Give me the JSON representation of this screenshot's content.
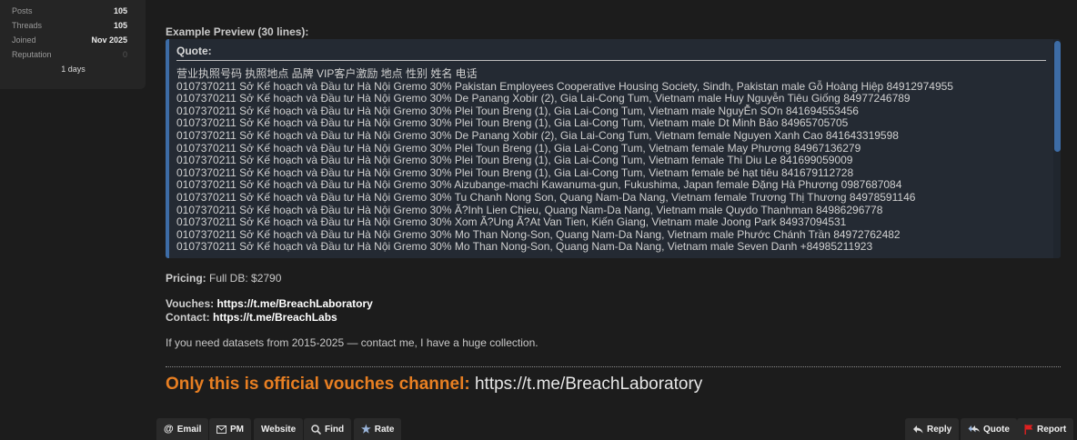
{
  "user_stats": {
    "posts_label": "Posts",
    "posts_value": "105",
    "threads_label": "Threads",
    "threads_value": "105",
    "joined_label": "Joined",
    "joined_value": "Nov 2025",
    "reputation_label": "Reputation",
    "reputation_value": "0",
    "days": "1 days"
  },
  "preview": {
    "title": "Example Preview (30 lines):",
    "quote_label": "Quote:",
    "lines": [
      "营业执照号码 执照地点 品牌 VIP客户激励 地点 性别 姓名 电话",
      "0107370211 Sở Kế hoạch và Đầu tư Hà Nội Gremo 30% Pakistan Employees Cooperative Housing Society, Sindh, Pakistan male Gỗ Hoàng Hiệp 84912974955",
      "0107370211 Sở Kế hoạch và Đầu tư Hà Nội Gremo 30% De Panang Xobir (2), Gia Lai-Cong Tum, Vietnam male Huy Nguyễn Tiêu Giống 84977246789",
      "0107370211 Sở Kế hoạch và Đầu tư Hà Nội Gremo 30% Plei Toun Breng (1), Gia Lai-Cong Tum, Vietnam male NguyỄn SƠn 841694553456",
      "0107370211 Sở Kế hoạch và Đầu tư Hà Nội Gremo 30% Plei Toun Breng (1), Gia Lai-Cong Tum, Vietnam male Dt Minh Bảo 84965705705",
      "0107370211 Sở Kế hoạch và Đầu tư Hà Nội Gremo 30% De Panang Xobir (2), Gia Lai-Cong Tum, Vietnam female Nguyen Xanh Cao 841643319598",
      "0107370211 Sở Kế hoạch và Đầu tư Hà Nội Gremo 30% Plei Toun Breng (1), Gia Lai-Cong Tum, Vietnam female May Phương 84967136279",
      "0107370211 Sở Kế hoạch và Đầu tư Hà Nội Gremo 30% Plei Toun Breng (1), Gia Lai-Cong Tum, Vietnam female Thi Diu Le 841699059009",
      "0107370211 Sở Kế hoạch và Đầu tư Hà Nội Gremo 30% Plei Toun Breng (1), Gia Lai-Cong Tum, Vietnam female bé hạt tiêu 841679112728",
      "0107370211 Sở Kế hoạch và Đầu tư Hà Nội Gremo 30% Aizubange-machi Kawanuma-gun, Fukushima, Japan female Đặng Hà Phương 0987687084",
      "0107370211 Sở Kế hoạch và Đầu tư Hà Nội Gremo 30% Tu Chanh Nong Son, Quang Nam-Da Nang, Vietnam female Trương Thị Thương 84978591146",
      "0107370211 Sở Kế hoạch và Đầu tư Hà Nội Gremo 30% Ã?Inh Lien Chieu, Quang Nam-Da Nang, Vietnam male Quydo Thanhman 84986296778",
      "0107370211 Sở Kế hoạch và Đầu tư Hà Nội Gremo 30% Xom Ã?Ung Ã?At Van Tien, Kiến Giang, Vietnam male Joong Park 84937094531",
      "0107370211 Sở Kế hoạch và Đầu tư Hà Nội Gremo 30% Mo Than Nong-Son, Quang Nam-Da Nang, Vietnam male Phước Chánh Trần 84972762482",
      "0107370211 Sở Kế hoạch và Đầu tư Hà Nội Gremo 30% Mo Than Nong-Son, Quang Nam-Da Nang, Vietnam male Seven Danh +84985211923"
    ]
  },
  "pricing": {
    "label": "Pricing:",
    "value": "Full DB: $2790"
  },
  "vouches": {
    "label": "Vouches:",
    "value": "https://t.me/BreachLaboratory"
  },
  "contact": {
    "label": "Contact:",
    "value": "https://t.me/BreachLabs"
  },
  "note": "If you need datasets from 2015-2025 — contact me, I have a huge collection.",
  "official": {
    "prefix": "Only this is official vouches channel:",
    "url": "https://t.me/BreachLaboratory"
  },
  "actions": {
    "email": "Email",
    "pm": "PM",
    "website": "Website",
    "find": "Find",
    "rate": "Rate",
    "reply": "Reply",
    "quote": "Quote",
    "report": "Report"
  },
  "colors": {
    "accent_orange": "#e87f22",
    "quote_border": "#3d6ca6",
    "report_flag": "#e02020"
  }
}
